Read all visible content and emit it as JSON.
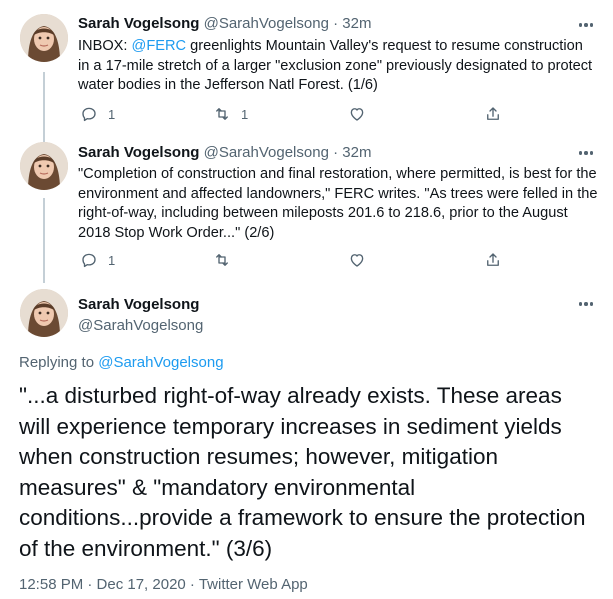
{
  "tweets": [
    {
      "name": "Sarah Vogelsong",
      "handle": "@SarahVogelsong",
      "sep": "·",
      "time": "32m",
      "text_prefix": "INBOX: ",
      "mention": "@FERC",
      "text_suffix": " greenlights Mountain Valley's request to resume construction in a 17-mile stretch of a larger \"exclusion zone\" previously designated to protect water bodies in the Jefferson Natl Forest. (1/6)",
      "replies": "1",
      "retweets": "1",
      "likes": ""
    },
    {
      "name": "Sarah Vogelsong",
      "handle": "@SarahVogelsong",
      "sep": "·",
      "time": "32m",
      "text": "\"Completion of construction and final restoration, where permitted, is best for the environment and affected landowners,\" FERC writes. \"As trees were felled in the right-of-way, including between mileposts 201.6 to 218.6, prior to the August 2018 Stop Work Order...\" (2/6)",
      "replies": "1",
      "retweets": "",
      "likes": ""
    }
  ],
  "main_tweet": {
    "name": "Sarah Vogelsong",
    "handle": "@SarahVogelsong",
    "replying_label": "Replying to ",
    "replying_handle": "@SarahVogelsong",
    "text": "\"...a disturbed right-of-way already exists. These areas will experience temporary increases in sediment yields when construction resumes; however, mitigation measures\" & \"mandatory environmental conditions...provide a framework to ensure the protection of the environment.\" (3/6)",
    "timestamp": "12:58 PM · Dec 17, 2020 · Twitter Web App"
  },
  "icons": [
    "reply-icon",
    "retweet-icon",
    "like-icon",
    "share-icon",
    "more-icon",
    "avatar"
  ],
  "colors": {
    "link": "#1d9bf0",
    "muted": "#536471",
    "thread_line": "#c4cfd6"
  }
}
